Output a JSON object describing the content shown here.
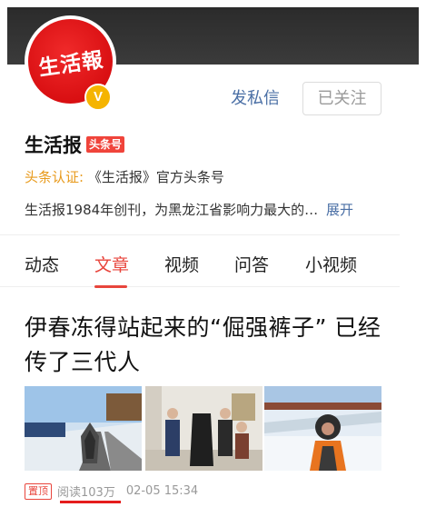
{
  "profile": {
    "logo_text": "生活報",
    "verified_badge": "V",
    "name": "生活报",
    "name_tag": "头条号",
    "verify_label": "头条认证:",
    "verify_text": "《生活报》官方头条号",
    "bio": "生活报1984年创刊，为黑龙江省影响力最大的…",
    "expand_label": "展开"
  },
  "actions": {
    "message_label": "发私信",
    "follow_label": "已关注"
  },
  "tabs": [
    {
      "label": "动态"
    },
    {
      "label": "文章"
    },
    {
      "label": "视频"
    },
    {
      "label": "问答"
    },
    {
      "label": "小视频"
    }
  ],
  "active_tab": "文章",
  "article": {
    "title": "伊春冻得站起来的“倔强裤子” 已经传了三代人",
    "pin_label": "置顶",
    "reads": "阅读103万",
    "timestamp": "02-05 15:34"
  },
  "icons": [
    "verified-badge-icon"
  ],
  "colors": {
    "accent": "#e8453c",
    "link": "#4a6fa5",
    "verify_label": "#e89a1c"
  }
}
